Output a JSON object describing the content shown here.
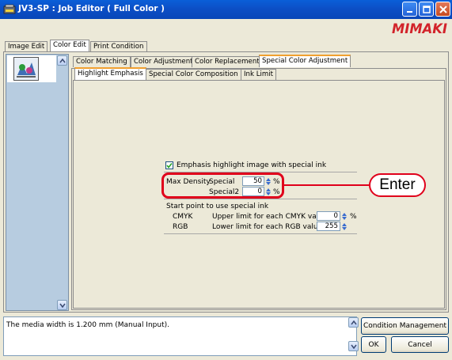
{
  "window": {
    "title": "JV3-SP : Job Editor ( Full Color )"
  },
  "brand": {
    "logo_text": "MIMAKI",
    "color": "#d2232a"
  },
  "main_tabs": [
    {
      "label": "Image Edit"
    },
    {
      "label": "Color Edit"
    },
    {
      "label": "Print Condition"
    }
  ],
  "color_edit_tabs": [
    {
      "label": "Color Matching"
    },
    {
      "label": "Color Adjustment"
    },
    {
      "label": "Color Replacement"
    },
    {
      "label": "Special Color Adjustment"
    }
  ],
  "special_tabs": [
    {
      "label": "Highlight Emphasis"
    },
    {
      "label": "Special Color Composition"
    },
    {
      "label": "Ink Limit"
    }
  ],
  "form": {
    "checkbox_label": "Emphasis highlight image with special ink",
    "checked": true,
    "max_density_label": "Max Density",
    "special_label": "Special",
    "special_value": "50",
    "special2_label": "Special2",
    "special2_value": "0",
    "percent": "%",
    "start_point_label": "Start point to use special ink",
    "cmyk_label": "CMYK",
    "cmyk_desc": "Upper limit for each CMYK value",
    "cmyk_value": "0",
    "rgb_label": "RGB",
    "rgb_desc": "Lower limit for each RGB value",
    "rgb_value": "255"
  },
  "callout": {
    "label": "Enter",
    "color": "#e0001b"
  },
  "status": {
    "text": "The media width is 1.200 mm (Manual Input)."
  },
  "buttons": {
    "condition_management": "Condition Management",
    "ok": "OK",
    "cancel": "Cancel"
  }
}
